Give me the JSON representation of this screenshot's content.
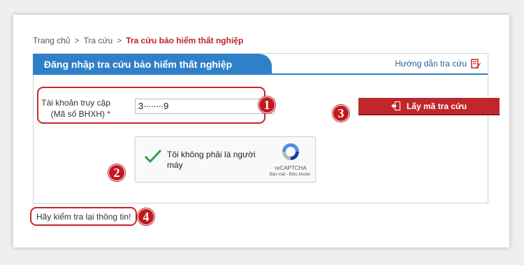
{
  "breadcrumb": {
    "home": "Trang chủ",
    "separator": ">",
    "lookup": "Tra cứu",
    "current": "Tra cứu bảo hiểm thất nghiệp"
  },
  "panel": {
    "title": "Đăng nhập tra cứu bảo hiểm thất nghiệp",
    "guide_link": "Hướng dẫn tra cứu"
  },
  "form": {
    "account_label": "Tài khoản truy cập",
    "account_sublabel": "(Mã số BHXH)",
    "required_mark": "*",
    "account_value": "3∙∙∙∙∙∙∙∙9",
    "submit_label": "Lấy mã tra cứu"
  },
  "captcha": {
    "label": "Tôi không phải là người máy",
    "brand": "reCAPTCHA",
    "links": "Bảo mật - Điều khoản",
    "checked": true
  },
  "message": "Hãy kiểm tra lại thông tin!",
  "annotations": {
    "b1": "1",
    "b2": "2",
    "b3": "3",
    "b4": "4"
  },
  "colors": {
    "accent": "#2f80c8",
    "button": "#c0272d",
    "annotation": "#c0191f"
  }
}
